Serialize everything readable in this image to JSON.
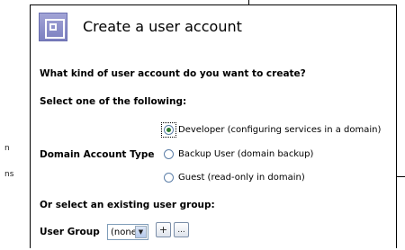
{
  "background": {
    "fragments": [
      "n",
      "ns"
    ]
  },
  "dialog": {
    "title": "Create a user account",
    "question": "What kind of user account do you want to create?",
    "select_label": "Select one of the following:",
    "field_label": "Domain Account Type",
    "options": [
      {
        "label": "Developer (configuring services in a domain)",
        "checked": true
      },
      {
        "label": "Backup User (domain backup)",
        "checked": false
      },
      {
        "label": "Guest (read-only in domain)",
        "checked": false
      }
    ],
    "group_section_label": "Or select an existing user group:",
    "user_group_label": "User Group",
    "user_group_value": "(none)",
    "add_button_label": "+",
    "more_button_label": "...",
    "colors": {
      "icon_fill": "#8d90cb",
      "radio_dot": "#2e7d32",
      "radio_border": "#5d7fa8"
    }
  }
}
